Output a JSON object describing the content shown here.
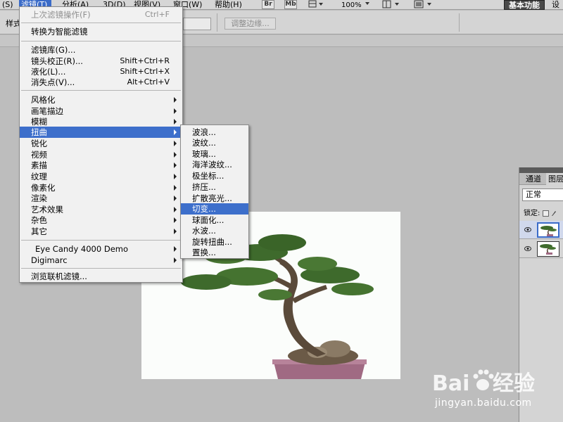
{
  "menubar": {
    "items": [
      {
        "label": "(S)"
      },
      {
        "label": "滤镜(T)"
      },
      {
        "label": "分析(A)"
      },
      {
        "label": "3D(D)"
      },
      {
        "label": "视图(V)"
      },
      {
        "label": "窗口(W)"
      },
      {
        "label": "帮助(H)"
      }
    ],
    "bridge_label": "Br",
    "minibridge_label": "Mb",
    "zoom": "100%",
    "workspace": "基本功能",
    "workspace_more": "设"
  },
  "options": {
    "style_label": "样式",
    "refine_edge": "调整边缘..."
  },
  "filter_menu": {
    "items": [
      {
        "label": "上次滤镜操作(F)",
        "shortcut": "Ctrl+F"
      },
      {
        "label": "转换为智能滤镜",
        "shortcut": ""
      },
      {
        "label": "滤镜库(G)...",
        "shortcut": ""
      },
      {
        "label": "镜头校正(R)...",
        "shortcut": "Shift+Ctrl+R"
      },
      {
        "label": "液化(L)...",
        "shortcut": "Shift+Ctrl+X"
      },
      {
        "label": "消失点(V)...",
        "shortcut": "Alt+Ctrl+V"
      },
      {
        "label": "风格化",
        "shortcut": ""
      },
      {
        "label": "画笔描边",
        "shortcut": ""
      },
      {
        "label": "模糊",
        "shortcut": ""
      },
      {
        "label": "扭曲",
        "shortcut": ""
      },
      {
        "label": "锐化",
        "shortcut": ""
      },
      {
        "label": "视频",
        "shortcut": ""
      },
      {
        "label": "素描",
        "shortcut": ""
      },
      {
        "label": "纹理",
        "shortcut": ""
      },
      {
        "label": "像素化",
        "shortcut": ""
      },
      {
        "label": "渲染",
        "shortcut": ""
      },
      {
        "label": "艺术效果",
        "shortcut": ""
      },
      {
        "label": "杂色",
        "shortcut": ""
      },
      {
        "label": "其它",
        "shortcut": ""
      },
      {
        "label": "Eye Candy 4000 Demo",
        "shortcut": ""
      },
      {
        "label": "Digimarc",
        "shortcut": ""
      },
      {
        "label": "浏览联机滤镜...",
        "shortcut": ""
      }
    ]
  },
  "distort_menu": {
    "items": [
      {
        "label": "波浪..."
      },
      {
        "label": "波纹..."
      },
      {
        "label": "玻璃..."
      },
      {
        "label": "海洋波纹..."
      },
      {
        "label": "极坐标..."
      },
      {
        "label": "挤压..."
      },
      {
        "label": "扩散亮光..."
      },
      {
        "label": "切变..."
      },
      {
        "label": "球面化..."
      },
      {
        "label": "水波..."
      },
      {
        "label": "旋转扭曲..."
      },
      {
        "label": "置换..."
      }
    ]
  },
  "layers_panel": {
    "tabs": [
      {
        "label": "通道"
      },
      {
        "label": "图层"
      }
    ],
    "blend_mode": "正常",
    "lock_label": "锁定:"
  },
  "watermark": {
    "logo_text": "Bai du 经验",
    "url": "jingyan.baidu.com"
  },
  "colors": {
    "menu_highlight": "#3d6fcb",
    "workspace_bg": "#bdbdbd",
    "pot": "#a06a83"
  }
}
